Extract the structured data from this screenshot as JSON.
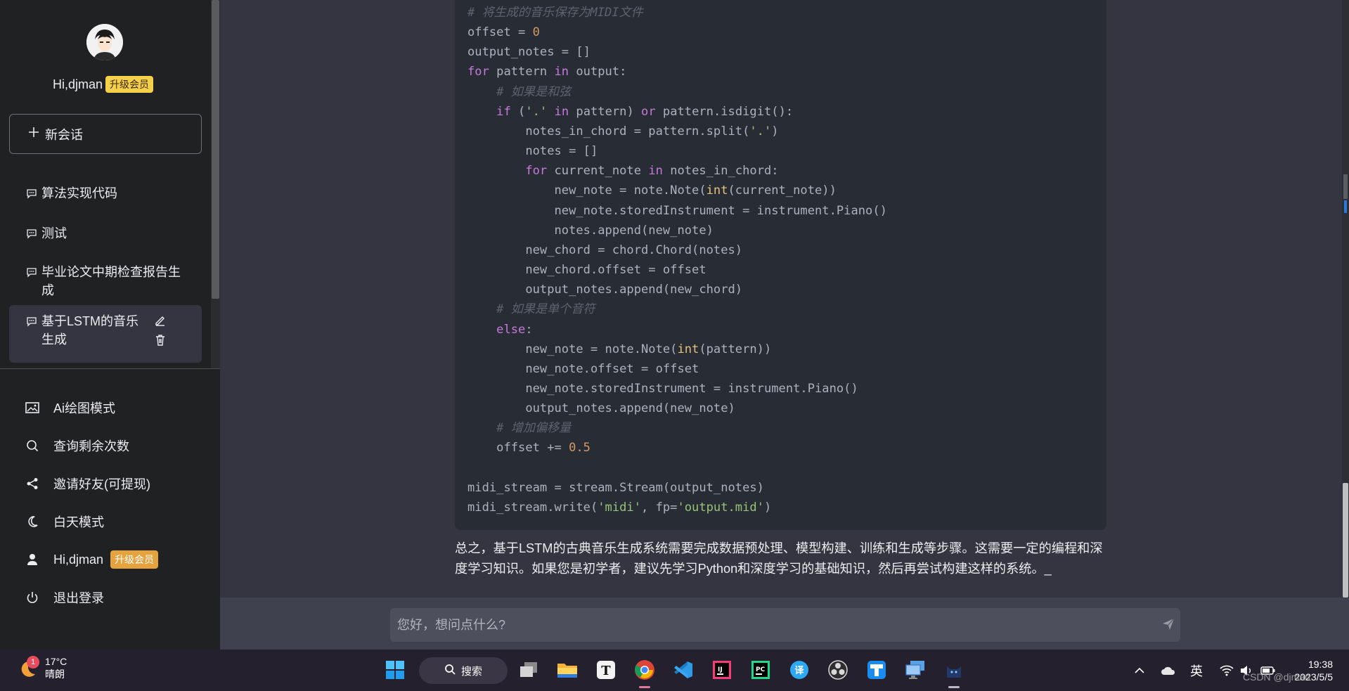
{
  "sidebar": {
    "user_greeting": "Hi,djman",
    "vip_badge": "升级会员",
    "new_chat": "新会话",
    "conversations": [
      {
        "title": "算法实现代码"
      },
      {
        "title": "测试"
      },
      {
        "title": "毕业论文中期检查报告生成"
      },
      {
        "title": "基于LSTM的音乐生成"
      }
    ],
    "menu": [
      {
        "label": "Ai绘图模式",
        "icon": "image-icon"
      },
      {
        "label": "查询剩余次数",
        "icon": "search-icon"
      },
      {
        "label": "邀请好友(可提现)",
        "icon": "share-icon"
      },
      {
        "label": "白天模式",
        "icon": "moon-icon"
      },
      {
        "label": "Hi,djman",
        "icon": "user-icon",
        "badge": "升级会员"
      },
      {
        "label": "退出登录",
        "icon": "power-icon"
      }
    ]
  },
  "code_lines": [
    [
      [
        "cm",
        "# 将生成的音乐保存为MIDI文件"
      ]
    ],
    [
      [
        "",
        "offset = "
      ],
      [
        "num",
        "0"
      ]
    ],
    [
      [
        "",
        "output_notes = []"
      ]
    ],
    [
      [
        "kw",
        "for"
      ],
      [
        "",
        " pattern "
      ],
      [
        "kw",
        "in"
      ],
      [
        "",
        " output:"
      ]
    ],
    [
      [
        "",
        "    "
      ],
      [
        "cm",
        "# 如果是和弦"
      ]
    ],
    [
      [
        "",
        "    "
      ],
      [
        "kw",
        "if"
      ],
      [
        "",
        " ("
      ],
      [
        "str",
        "'.'"
      ],
      [
        "",
        " "
      ],
      [
        "kw",
        "in"
      ],
      [
        "",
        " pattern) "
      ],
      [
        "kw",
        "or"
      ],
      [
        "",
        " pattern.isdigit():"
      ]
    ],
    [
      [
        "",
        "        notes_in_chord = pattern.split("
      ],
      [
        "str",
        "'.'"
      ],
      [
        "",
        ")"
      ]
    ],
    [
      [
        "",
        "        notes = []"
      ]
    ],
    [
      [
        "",
        "        "
      ],
      [
        "kw",
        "for"
      ],
      [
        "",
        " current_note "
      ],
      [
        "kw",
        "in"
      ],
      [
        "",
        " notes_in_chord:"
      ]
    ],
    [
      [
        "",
        "            new_note = note.Note("
      ],
      [
        "bi",
        "int"
      ],
      [
        "",
        "(current_note))"
      ]
    ],
    [
      [
        "",
        "            new_note.storedInstrument = instrument.Piano()"
      ]
    ],
    [
      [
        "",
        "            notes.append(new_note)"
      ]
    ],
    [
      [
        "",
        "        new_chord = chord.Chord(notes)"
      ]
    ],
    [
      [
        "",
        "        new_chord.offset = offset"
      ]
    ],
    [
      [
        "",
        "        output_notes.append(new_chord)"
      ]
    ],
    [
      [
        "",
        "    "
      ],
      [
        "cm",
        "# 如果是单个音符"
      ]
    ],
    [
      [
        "",
        "    "
      ],
      [
        "kw",
        "else"
      ],
      [
        "",
        ":"
      ]
    ],
    [
      [
        "",
        "        new_note = note.Note("
      ],
      [
        "bi",
        "int"
      ],
      [
        "",
        "(pattern))"
      ]
    ],
    [
      [
        "",
        "        new_note.offset = offset"
      ]
    ],
    [
      [
        "",
        "        new_note.storedInstrument = instrument.Piano()"
      ]
    ],
    [
      [
        "",
        "        output_notes.append(new_note)"
      ]
    ],
    [
      [
        "",
        "    "
      ],
      [
        "cm",
        "# 增加偏移量"
      ]
    ],
    [
      [
        "",
        "    offset += "
      ],
      [
        "num",
        "0.5"
      ]
    ],
    [
      [
        "",
        ""
      ]
    ],
    [
      [
        "",
        "midi_stream = stream.Stream(output_notes)"
      ]
    ],
    [
      [
        "",
        "midi_stream.write("
      ],
      [
        "str",
        "'midi'"
      ],
      [
        "",
        ", fp="
      ],
      [
        "str",
        "'output.mid'"
      ],
      [
        "",
        ")"
      ]
    ]
  ],
  "summary": "总之，基于LSTM的古典音乐生成系统需要完成数据预处理、模型构建、训练和生成等步骤。这需要一定的编程和深度学习知识。如果您是初学者，建议先学习Python和深度学习的基础知识，然后再尝试构建这样的系统。_",
  "input": {
    "placeholder": "您好，想问点什么?"
  },
  "taskbar": {
    "weather_temp": "17°C",
    "weather_desc": "晴朗",
    "weather_notif": "1",
    "search_label": "搜索",
    "ime": "英",
    "time": "19:38",
    "date": "2023/5/5",
    "watermark": "CSDN @djman"
  }
}
